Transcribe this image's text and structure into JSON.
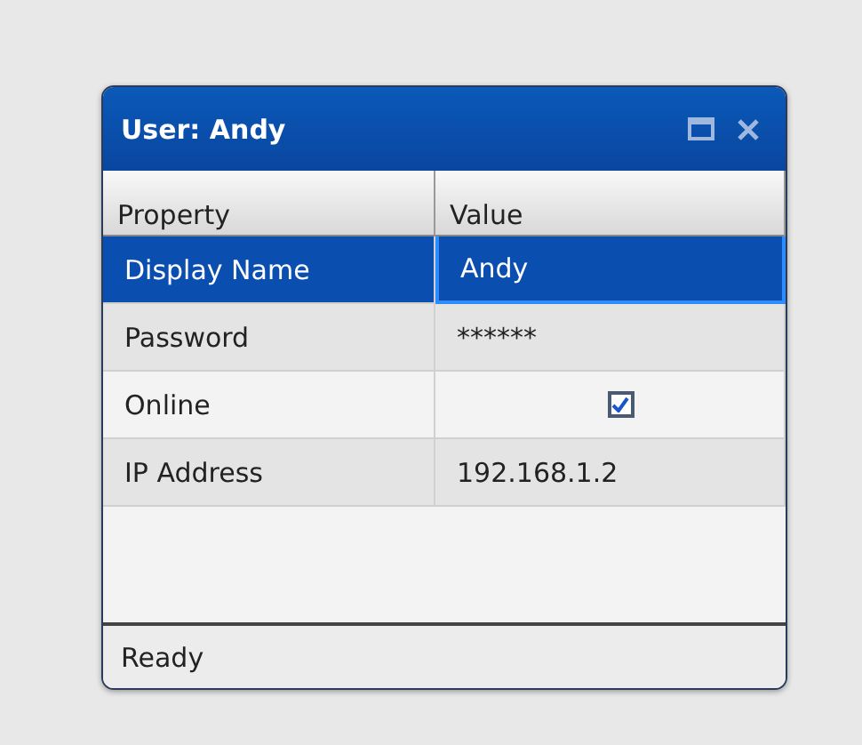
{
  "window": {
    "title": "User: Andy"
  },
  "table": {
    "columns": [
      "Property",
      "Value"
    ],
    "rows": [
      {
        "property": "Display Name",
        "kind": "text",
        "value": "Andy",
        "selected": true
      },
      {
        "property": "Password",
        "kind": "text",
        "value": "******",
        "selected": false
      },
      {
        "property": "Online",
        "kind": "checkbox",
        "checked": true,
        "selected": false
      },
      {
        "property": "IP Address",
        "kind": "text",
        "value": "192.168.1.2",
        "selected": false
      }
    ]
  },
  "status_bar": "Ready"
}
